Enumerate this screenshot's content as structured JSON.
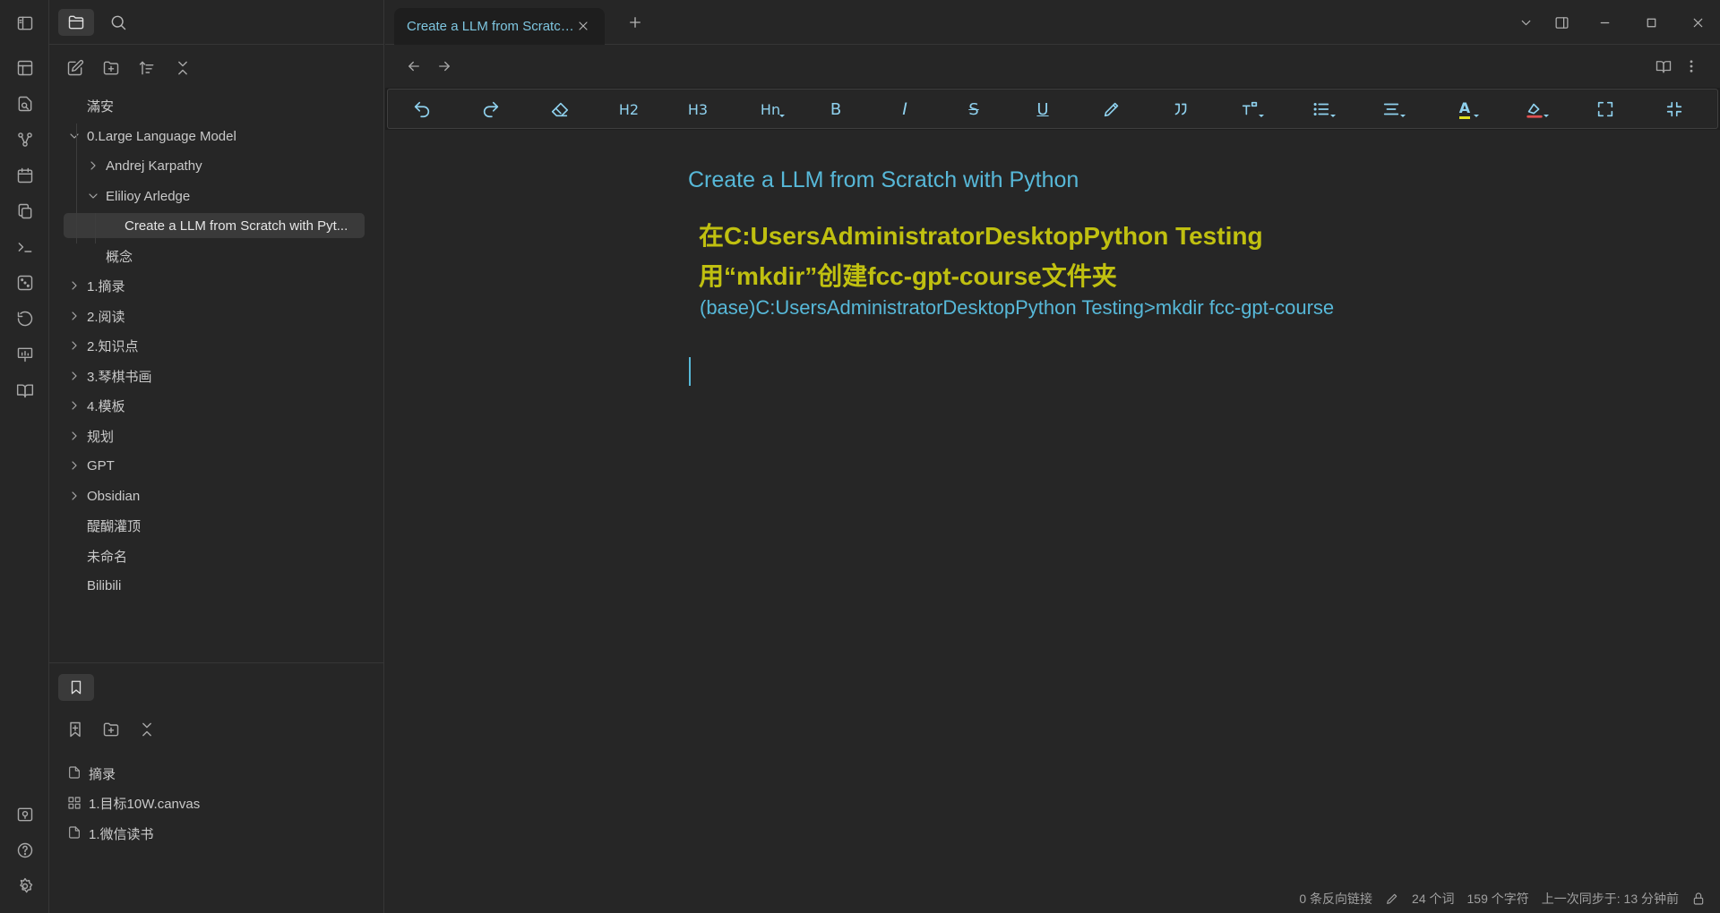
{
  "sidebar": {
    "tree": [
      {
        "label": "滿安",
        "depth": 0,
        "chevron": "none"
      },
      {
        "label": "0.Large Language Model",
        "depth": 0,
        "chevron": "down"
      },
      {
        "label": "Andrej Karpathy",
        "depth": 1,
        "chevron": "right"
      },
      {
        "label": "Elilioy Arledge",
        "depth": 1,
        "chevron": "down"
      },
      {
        "label": "Create a LLM from Scratch with Pyt...",
        "depth": 2,
        "chevron": "none",
        "selected": true
      },
      {
        "label": "概念",
        "depth": 1,
        "chevron": "none"
      },
      {
        "label": "1.摘录",
        "depth": 0,
        "chevron": "right"
      },
      {
        "label": "2.阅读",
        "depth": 0,
        "chevron": "right"
      },
      {
        "label": "2.知识点",
        "depth": 0,
        "chevron": "right"
      },
      {
        "label": "3.琴棋书画",
        "depth": 0,
        "chevron": "right"
      },
      {
        "label": "4.模板",
        "depth": 0,
        "chevron": "right"
      },
      {
        "label": "规划",
        "depth": 0,
        "chevron": "right"
      },
      {
        "label": "GPT",
        "depth": 0,
        "chevron": "right"
      },
      {
        "label": "Obsidian",
        "depth": 0,
        "chevron": "right"
      },
      {
        "label": "醍醐灌顶",
        "depth": 0,
        "chevron": "none"
      },
      {
        "label": "未命名",
        "depth": 0,
        "chevron": "none"
      },
      {
        "label": "Bilibili",
        "depth": 0,
        "chevron": "none"
      }
    ],
    "bookmarks": [
      {
        "label": "摘录",
        "icon": "file-icon"
      },
      {
        "label": "1.目标10W.canvas",
        "icon": "canvas-icon"
      },
      {
        "label": "1.微信读书",
        "icon": "file-icon"
      }
    ]
  },
  "tab": {
    "title": "Create a LLM from Scratch..."
  },
  "note": {
    "title": "Create a LLM from Scratch with Python",
    "heading": "在C:UsersAdministratorDesktopPython Testing用“mkdir”创建fcc-gpt-course文件夹",
    "paragraph": "(base)C:UsersAdministratorDesktopPython Testing>mkdir fcc-gpt-course"
  },
  "toolbar": {
    "h2": "H2",
    "h3": "H3",
    "hn": "Hn",
    "bold": "B",
    "italic": "I",
    "strike": "S",
    "underline": "U",
    "text_color_glyph": "A",
    "highlight_color": "#e0e020",
    "font_color_bar": "#e0e020",
    "highlight_bar": "#e05050"
  },
  "status": {
    "backlinks": "0 条反向链接",
    "words": "24 个词",
    "chars": "159 个字符",
    "sync": "上一次同步于:  13 分钟前"
  },
  "colors": {
    "accent": "#57b8d8",
    "heading": "#c0c010",
    "background": "#262626"
  }
}
